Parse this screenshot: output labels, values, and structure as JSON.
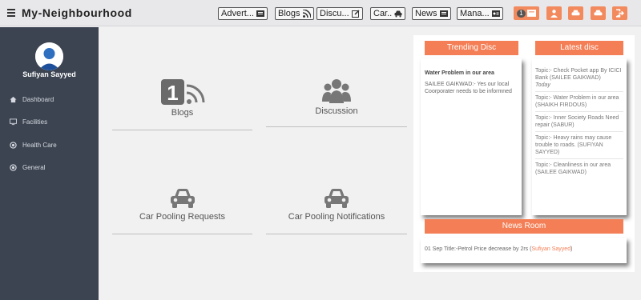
{
  "app": {
    "title": "My-Neighbourhood"
  },
  "nav": {
    "buttons": [
      {
        "label": "Advert...",
        "icon": "newspaper-icon"
      },
      {
        "label": "Blogs",
        "icon": "rss-icon"
      },
      {
        "label": "Discu...",
        "icon": "edit-icon"
      },
      {
        "label": "Car..",
        "icon": "car-icon"
      },
      {
        "label": "News",
        "icon": "newspaper-icon"
      },
      {
        "label": "Mana...",
        "icon": "id-card-icon"
      }
    ],
    "notification_count": "1",
    "accent_color": "#f28a5e"
  },
  "sidebar": {
    "user_name": "Sufiyan Sayyed",
    "items": [
      {
        "label": "Dashboard",
        "icon": "home-icon"
      },
      {
        "label": "Facilities",
        "icon": "monitor-icon"
      },
      {
        "label": "Health Care",
        "icon": "circle-dot-icon"
      },
      {
        "label": "General",
        "icon": "circle-dot-icon"
      }
    ]
  },
  "tiles": {
    "blogs": {
      "label": "Blogs",
      "badge": "1"
    },
    "discussion": {
      "label": "Discussion"
    },
    "car_requests": {
      "label": "Car Pooling Requests"
    },
    "car_notifications": {
      "label": "Car Pooling Notifications"
    }
  },
  "trending": {
    "tab": "Trending Disc",
    "title": "Water Problem in our area",
    "body": "SAILEE GAIKWAD:- Yes our local Coorporater needs to be informned"
  },
  "latest": {
    "tab": "Latest disc",
    "items": [
      {
        "text": "Topic:- Check Pocket app By ICICI Bank (SAILEE GAIKWAD)",
        "when": "Today"
      },
      {
        "text": "Topic:- Water Problem in our area (SHAIKH FIRDOUS)"
      },
      {
        "text": "Topic:- Inner Society Roads Need repair (SABUR)"
      },
      {
        "text": "Topic:- Heavy rains may cause trouble to roads. (SUFIYAN SAYYED)"
      },
      {
        "text": "Topic:- Cleanliness in our area (SAILEE GAIKWAD)"
      }
    ]
  },
  "news": {
    "tab": "News Room",
    "item_text": "01 Sep Title:-Petrol Price decrease by 2rs (",
    "item_author": "Sufiyan Sayyed",
    "item_close": ")"
  }
}
